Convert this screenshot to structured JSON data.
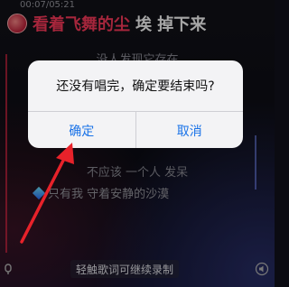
{
  "player": {
    "timestamp": "00:07/05:21",
    "current_lyric_sung": "看着飞舞的尘",
    "current_lyric_unsung": "埃 掉下来",
    "lyric_2": "没人发现它存在",
    "lyric_3": "不应该 一个人 发呆",
    "lyric_4": "只有我 守着安静的沙漠",
    "hint": "轻触歌词可继续录制"
  },
  "dialog": {
    "message": "还没有唱完，确定要结束吗?",
    "confirm_label": "确定",
    "cancel_label": "取消"
  },
  "colors": {
    "accent": "#ff3b5c",
    "dialog_button": "#1a73e8",
    "annotation_arrow": "#e8222a"
  },
  "icons": [
    "avatar",
    "diamond-icon",
    "mic-left-icon",
    "speaker-icon"
  ]
}
